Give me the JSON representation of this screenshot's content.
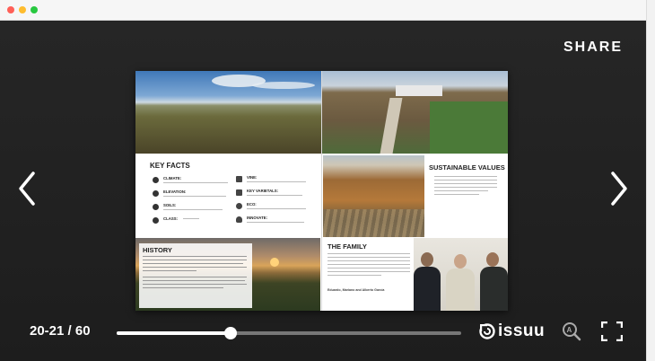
{
  "window": {
    "dots": [
      "#ff5f57",
      "#febc2e",
      "#28c840"
    ]
  },
  "viewer": {
    "share_label": "SHARE",
    "page_indicator": "20-21 / 60",
    "progress_fraction": 0.33,
    "brand": "issuu"
  },
  "spread": {
    "key_facts_heading": "KEY FACTS",
    "facts_left": [
      {
        "label": "CLIMATE:",
        "icon": "sun-icon"
      },
      {
        "label": "ELEVATION:",
        "icon": "mountain-icon"
      },
      {
        "label": "SOILS:",
        "icon": "soil-icon"
      },
      {
        "label": "CLASS:",
        "icon": "bottle-icon"
      }
    ],
    "facts_right": [
      {
        "label": "VINE:",
        "icon": "vine-icon"
      },
      {
        "label": "KEY VARIETALS:",
        "icon": "grape-icon"
      },
      {
        "label": "ECO:",
        "icon": "globe-icon"
      },
      {
        "label": "INNOVATE:",
        "icon": "bulb-icon"
      }
    ],
    "sustainable_heading": "SUSTAINABLE VALUES",
    "history_heading": "HISTORY",
    "family_heading": "THE FAMILY",
    "family_caption": "Eduardo, Mariano and Alberto García"
  }
}
